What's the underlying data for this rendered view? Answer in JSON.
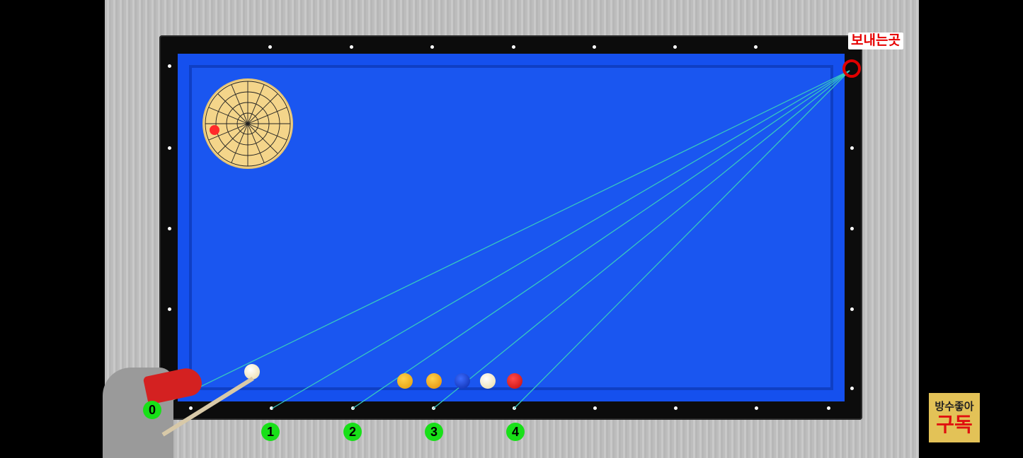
{
  "overlay": {
    "target_label": "보내는곳",
    "rail_numbers": [
      "0",
      "1",
      "2",
      "3",
      "4"
    ]
  },
  "channel_badge": {
    "line1": "방수좋아",
    "line2": "구독"
  },
  "colors": {
    "cloth": "#1a56f0",
    "rail": "#0c0c0c",
    "path_line": "#37c7c0",
    "marker_green": "#18e018",
    "target_red": "#e00000"
  }
}
